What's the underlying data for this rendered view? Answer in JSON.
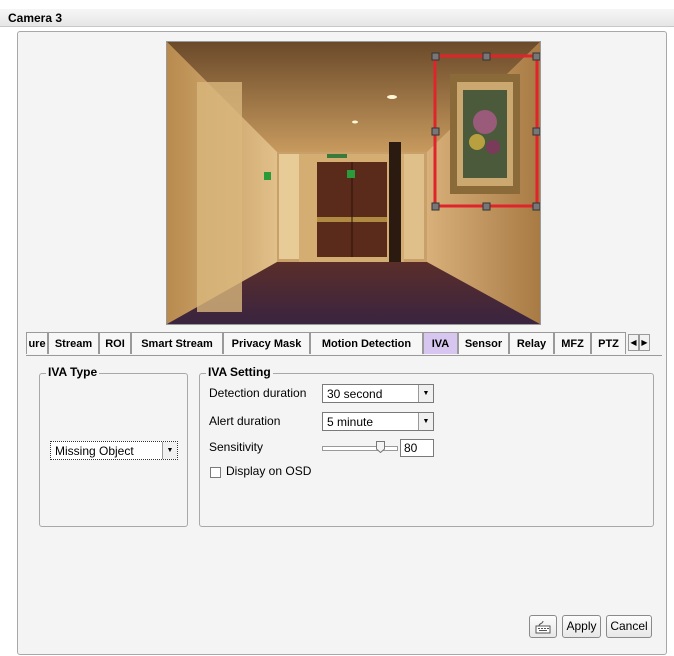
{
  "window": {
    "title": "Camera 3"
  },
  "tabs": [
    {
      "label": "ure",
      "active": false
    },
    {
      "label": "Stream",
      "active": false
    },
    {
      "label": "ROI",
      "active": false
    },
    {
      "label": "Smart Stream",
      "active": false
    },
    {
      "label": "Privacy Mask",
      "active": false
    },
    {
      "label": "Motion Detection",
      "active": false
    },
    {
      "label": "IVA",
      "active": true
    },
    {
      "label": "Sensor",
      "active": false
    },
    {
      "label": "Relay",
      "active": false
    },
    {
      "label": "MFZ",
      "active": false
    },
    {
      "label": "PTZ",
      "active": false
    }
  ],
  "tab_scroll": {
    "left_icon": "arrow-left-icon",
    "right_icon": "arrow-right-icon"
  },
  "iva_type": {
    "title": "IVA Type",
    "selected": "Missing Object"
  },
  "iva_setting": {
    "title": "IVA Setting",
    "detection_duration_label": "Detection duration",
    "detection_duration_value": "30 second",
    "alert_duration_label": "Alert duration",
    "alert_duration_value": "5 minute",
    "sensitivity_label": "Sensitivity",
    "sensitivity_value": "80",
    "display_osd_label": "Display on OSD",
    "display_osd_checked": false
  },
  "buttons": {
    "keyboard_icon": "keyboard-icon",
    "apply": "Apply",
    "cancel": "Cancel"
  },
  "colors": {
    "active_tab": "#d7c7f0",
    "selection_box": "#e0242c"
  }
}
